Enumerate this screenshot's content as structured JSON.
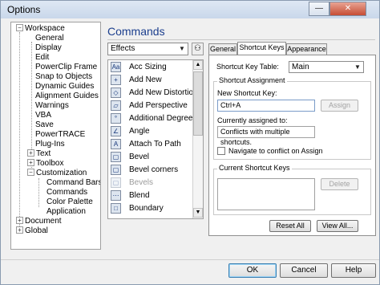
{
  "window": {
    "title": "Options",
    "minimize_glyph": "—",
    "close_glyph": "✕"
  },
  "tree": {
    "items": [
      {
        "label": "Workspace",
        "toggle": "−"
      },
      {
        "label": "General"
      },
      {
        "label": "Display"
      },
      {
        "label": "Edit"
      },
      {
        "label": "PowerClip Frame"
      },
      {
        "label": "Snap to Objects"
      },
      {
        "label": "Dynamic Guides"
      },
      {
        "label": "Alignment Guides"
      },
      {
        "label": "Warnings"
      },
      {
        "label": "VBA"
      },
      {
        "label": "Save"
      },
      {
        "label": "PowerTRACE"
      },
      {
        "label": "Plug-Ins"
      },
      {
        "label": "Text",
        "toggle": "+"
      },
      {
        "label": "Toolbox",
        "toggle": "+"
      },
      {
        "label": "Customization",
        "toggle": "−"
      },
      {
        "label": "Command Bars"
      },
      {
        "label": "Commands"
      },
      {
        "label": "Color Palette"
      },
      {
        "label": "Application"
      },
      {
        "label": "Document",
        "toggle": "+"
      },
      {
        "label": "Global",
        "toggle": "+"
      }
    ]
  },
  "commands": {
    "heading": "Commands",
    "category": "Effects",
    "find_icon_glyph": "⚇",
    "items": [
      {
        "label": "Acc Sizing",
        "icon": "Aa",
        "disabled": false
      },
      {
        "label": "Add New",
        "icon": "+",
        "disabled": false
      },
      {
        "label": "Add New Distortion",
        "icon": "◇",
        "disabled": false
      },
      {
        "label": "Add Perspective",
        "icon": "▱",
        "disabled": false
      },
      {
        "label": "Additional Degrees",
        "icon": "°",
        "disabled": false
      },
      {
        "label": "Angle",
        "icon": "∠",
        "disabled": false
      },
      {
        "label": "Attach To Path",
        "icon": "A",
        "disabled": false
      },
      {
        "label": "Bevel",
        "icon": "▢",
        "disabled": false
      },
      {
        "label": "Bevel corners",
        "icon": "▢",
        "disabled": false
      },
      {
        "label": "Bevels",
        "icon": "▢",
        "disabled": true
      },
      {
        "label": "Blend",
        "icon": "⋯",
        "disabled": false
      },
      {
        "label": "Boundary",
        "icon": "□",
        "disabled": false
      }
    ],
    "scroll_up": "▲",
    "scroll_down": "▼"
  },
  "tabs": [
    {
      "label": "General"
    },
    {
      "label": "Shortcut Keys"
    },
    {
      "label": "Appearance"
    }
  ],
  "shortcut": {
    "table_label": "Shortcut Key Table:",
    "table_value": "Main",
    "assignment_title": "Shortcut Assignment",
    "new_key_label": "New Shortcut Key:",
    "new_key_value": "Ctrl+A",
    "assign_button": "Assign",
    "currently_label": "Currently assigned to:",
    "currently_value": "Conflicts with multiple shortcuts.",
    "navigate_label": "Navigate to conflict on Assign",
    "navigate_checked": false,
    "current_keys_title": "Current Shortcut Keys",
    "delete_button": "Delete",
    "reset_all_button": "Reset All",
    "view_all_button": "View All..."
  },
  "footer": {
    "ok": "OK",
    "cancel": "Cancel",
    "help": "Help"
  }
}
